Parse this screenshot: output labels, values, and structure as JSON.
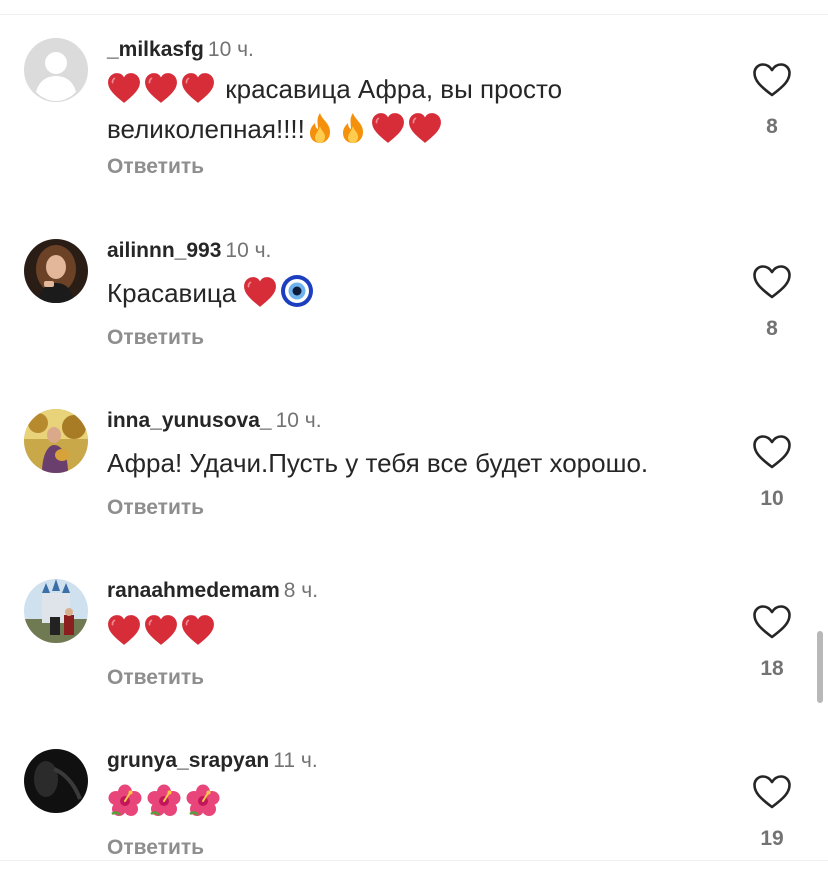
{
  "reply_label": "Ответить",
  "comments": [
    {
      "username": "_milkasfg",
      "time": "10 ч.",
      "text_line1_after_emoji": "красавица Афра, вы просто",
      "text_line2_before_emoji": "великолепная!!!!",
      "likes": "8",
      "emoji_sequence": [
        "heart",
        "heart",
        "heart",
        "fire",
        "fire",
        "heart",
        "heart"
      ]
    },
    {
      "username": "ailinnn_993",
      "time": "10 ч.",
      "text": "Красавица",
      "likes": "8",
      "emoji_sequence": [
        "heart",
        "nazar-amulet"
      ]
    },
    {
      "username": "inna_yunusova_",
      "time": "10 ч.",
      "text": "Афра! Удачи.Пусть у тебя все будет хорошо.",
      "likes": "10"
    },
    {
      "username": "ranaahmedemam",
      "time": "8 ч.",
      "likes": "18",
      "emoji_sequence": [
        "heart",
        "heart",
        "heart"
      ]
    },
    {
      "username": "grunya_srapyan",
      "time": "11 ч.",
      "likes": "19",
      "emoji_sequence": [
        "hibiscus",
        "hibiscus",
        "hibiscus"
      ]
    }
  ],
  "colors": {
    "text": "#262626",
    "secondary": "#737373",
    "reply": "#8e8e8e",
    "heart_emoji": "#d62d39",
    "fire_emoji": "#f4900c"
  }
}
